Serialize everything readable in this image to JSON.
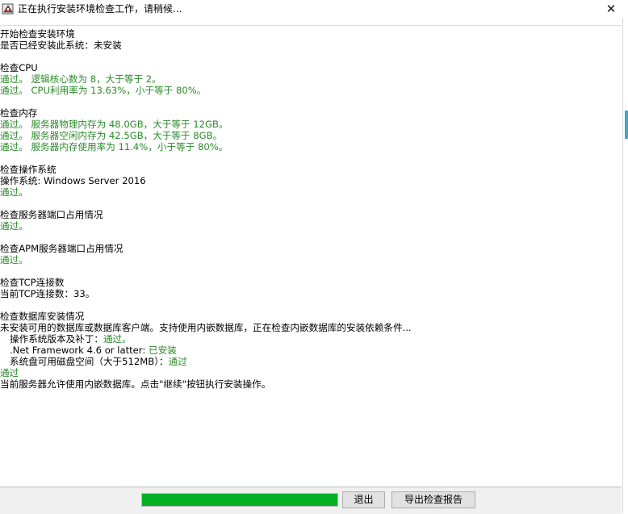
{
  "window": {
    "title": "正在执行安装环境检查工作，请稍候...",
    "close_glyph": "✕"
  },
  "log_lines": [
    {
      "text": "开始检查安装环境",
      "status": "normal"
    },
    {
      "text": "是否已经安装此系统：未安装",
      "status": "normal"
    },
    {
      "text": "检查CPU",
      "status": "normal"
    },
    {
      "text": "通过。 逻辑核心数为 8，大于等于 2。",
      "status": "pass"
    },
    {
      "text": "通过。 CPU利用率为 13.63%，小于等于 80%。",
      "status": "pass"
    },
    {
      "text": "检查内存",
      "status": "normal"
    },
    {
      "text": "通过。 服务器物理内存为 48.0GB，大于等于 12GB。",
      "status": "pass"
    },
    {
      "text": "通过。 服务器空闲内存为 42.5GB，大于等于 8GB。",
      "status": "pass"
    },
    {
      "text": "通过。 服务器内存使用率为 11.4%，小于等于 80%。",
      "status": "pass"
    },
    {
      "text": "检查操作系统",
      "status": "normal"
    },
    {
      "text": "操作系统: Windows Server 2016",
      "status": "normal"
    },
    {
      "text": "通过。",
      "status": "pass"
    },
    {
      "text": "检查服务器端口占用情况",
      "status": "normal"
    },
    {
      "text": "通过。",
      "status": "pass"
    },
    {
      "text": "检查APM服务器端口占用情况",
      "status": "normal"
    },
    {
      "text": "通过。",
      "status": "pass"
    },
    {
      "text": "检查TCP连接数",
      "status": "normal"
    },
    {
      "text": "当前TCP连接数：33。",
      "status": "normal"
    },
    {
      "text": "检查数据库安装情况",
      "status": "normal"
    },
    {
      "text": "未安装可用的数据库或数据库客户端。支持使用内嵌数据库，正在检查内嵌数据库的安装依赖条件...",
      "status": "normal"
    },
    {
      "label": "操作系统版本及补丁：",
      "value": "通过。",
      "indent": true
    },
    {
      "label": ".Net Framework 4.6 or latter: ",
      "value": "已安装",
      "indent": true
    },
    {
      "label": "系统盘可用磁盘空间（大于512MB）：",
      "value": "通过",
      "indent": true
    },
    {
      "text": "通过",
      "status": "pass"
    },
    {
      "text": "当前服务器允许使用内嵌数据库。点击\"继续\"按钮执行安装操作。",
      "status": "normal"
    }
  ],
  "progress": {
    "percent": 100,
    "color": "#06b025"
  },
  "buttons": {
    "exit_label": "退出",
    "export_label": "导出检查报告"
  }
}
